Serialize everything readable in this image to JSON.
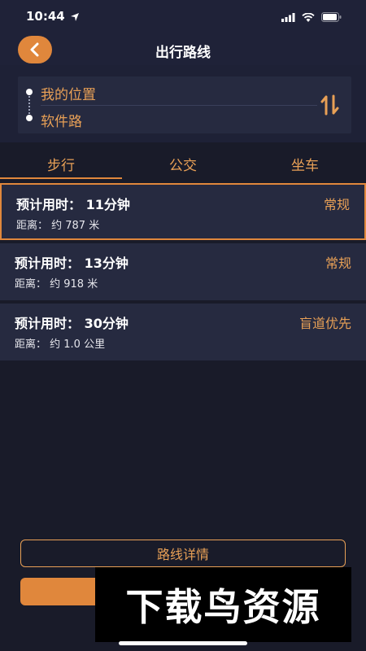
{
  "status_bar": {
    "time": "10:44"
  },
  "nav": {
    "title": "出行路线"
  },
  "route": {
    "from": "我的位置",
    "to": "软件路"
  },
  "tabs": [
    {
      "label": "步行",
      "active": true
    },
    {
      "label": "公交",
      "active": false
    },
    {
      "label": "坐车",
      "active": false
    }
  ],
  "routes": [
    {
      "time": "预计用时：  11分钟",
      "distance": "距离：  约 787 米",
      "tag": "常规"
    },
    {
      "time": "预计用时：  13分钟",
      "distance": "距离：  约 918 米",
      "tag": "常规"
    },
    {
      "time": "预计用时：  30分钟",
      "distance": "距离：  约 1.0 公里",
      "tag": "盲道优先"
    }
  ],
  "buttons": {
    "details": "路线详情"
  },
  "watermark": {
    "text": "下载鸟资源"
  },
  "colors": {
    "accent": "#e0873c",
    "background": "#191b29",
    "card": "#262a40"
  }
}
